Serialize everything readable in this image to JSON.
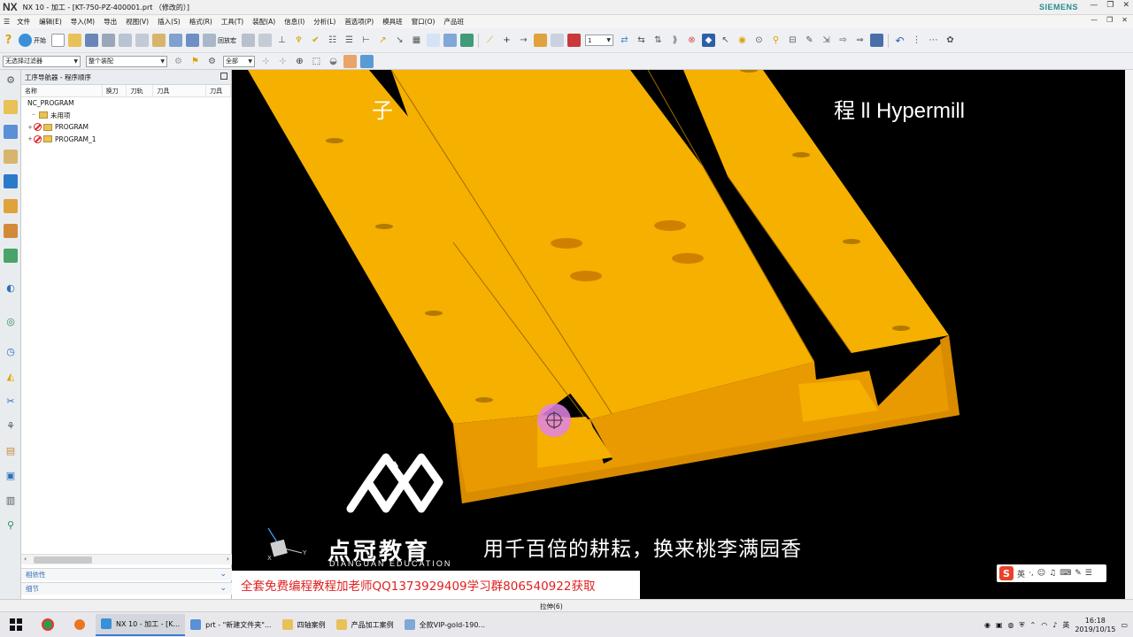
{
  "window": {
    "logo": "NX",
    "title": "NX 10 - 加工 - [KT-750-PZ-400001.prt （修改的）]",
    "brand": "SIEMENS"
  },
  "menu": [
    "文件",
    "编辑(E)",
    "导入(M)",
    "导出",
    "视图(V)",
    "插入(S)",
    "格式(R)",
    "工具(T)",
    "装配(A)",
    "信息(I)",
    "分析(L)",
    "首选项(P)",
    "模具班",
    "窗口(O)",
    "产品班"
  ],
  "toolbar1": {
    "start_label": "开始",
    "restore_label": "回放宏",
    "layer_value": "1"
  },
  "toolbar2": {
    "filter_value": "无选择过滤器",
    "assembly_value": "整个装配",
    "scope_value": "全部"
  },
  "navigator": {
    "title": "工序导航器 - 程序顺序",
    "columns": [
      "名称",
      "换刀",
      "刀轨",
      "刀具",
      "刀具"
    ],
    "tree": [
      {
        "label": "NC_PROGRAM",
        "level": 0,
        "icon": "none"
      },
      {
        "label": "未用项",
        "level": 1,
        "icon": "folder"
      },
      {
        "label": "PROGRAM",
        "level": 1,
        "icon": "program-forbidden"
      },
      {
        "label": "PROGRAM_1",
        "level": 1,
        "icon": "program-forbidden"
      }
    ],
    "sections": [
      "相依性",
      "细节"
    ]
  },
  "viewport": {
    "overlay_text": "程            ll Hypermill",
    "overlay_left": "子",
    "brand_cn": "点冠教育",
    "brand_en": "DIANGUAN EDUCATION",
    "slogan": "用千百倍的耕耘，换来桃李满园香",
    "promo": "全套免费编程教程加老师QQ1373929409学习群806540922获取",
    "ime_text": "英",
    "part_color": "#f5b000",
    "part_side_color": "#e89a00",
    "axis_x": "X",
    "axis_y": "Y"
  },
  "status": {
    "text": "拉伸(6)"
  },
  "taskbar": {
    "tasks": [
      {
        "label": "NX 10 - 加工 - [K...",
        "active": true
      },
      {
        "label": "prt - \"新建文件夹\"...",
        "active": false
      },
      {
        "label": "四轴案例",
        "active": false
      },
      {
        "label": "产品加工案例",
        "active": false
      },
      {
        "label": "全款VIP-gold-190...",
        "active": false
      }
    ],
    "tray_lang": "英",
    "time": "16:18",
    "date": "2019/10/15"
  }
}
